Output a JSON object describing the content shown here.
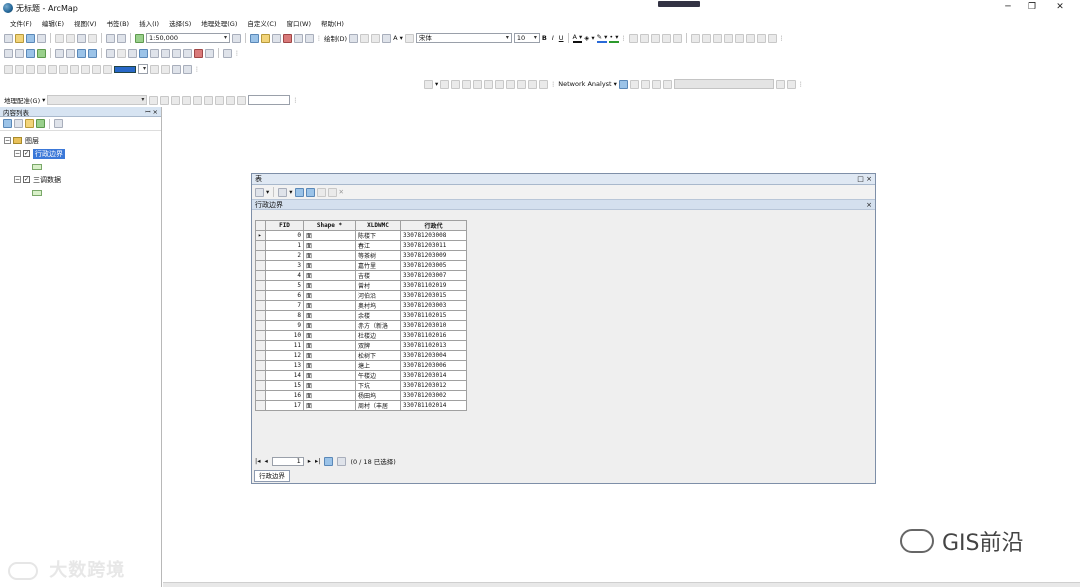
{
  "window": {
    "title": "无标题 - ArcMap"
  },
  "menu": [
    "文件(F)",
    "编辑(E)",
    "视图(V)",
    "书签(B)",
    "插入(I)",
    "选择(S)",
    "地理处理(G)",
    "自定义(C)",
    "窗口(W)",
    "帮助(H)"
  ],
  "toolbar": {
    "scale": "1:50,000",
    "drawing_label": "绘制(D)",
    "font_name": "宋体",
    "font_size": "10",
    "bold": "B",
    "italic": "I",
    "underline": "U",
    "network_analyst": "Network Analyst",
    "georef_label": "地理配准(G)"
  },
  "toc": {
    "title": "内容列表",
    "pin": "ꟷ ×",
    "root": "图层",
    "layers": [
      {
        "name": "行政边界",
        "selected": true,
        "checked": true
      },
      {
        "name": "三调数据",
        "selected": false,
        "checked": true
      }
    ]
  },
  "table": {
    "window_title": "表",
    "window_controls": "□ ×",
    "tab_title": "行政边界",
    "tab_close": "×",
    "columns": [
      "FID",
      "Shape *",
      "XLDWMC",
      "行政代"
    ],
    "rows": [
      [
        "0",
        "面",
        "陈楼下",
        "330781203008"
      ],
      [
        "1",
        "面",
        "春江",
        "330781203011"
      ],
      [
        "2",
        "面",
        "等茶树",
        "330781203009"
      ],
      [
        "3",
        "面",
        "嘉竹里",
        "330781203005"
      ],
      [
        "4",
        "面",
        "吉楼",
        "330781203007"
      ],
      [
        "5",
        "面",
        "曾村",
        "330781102019"
      ],
      [
        "6",
        "面",
        "河伯沿",
        "330781203015"
      ],
      [
        "7",
        "面",
        "奥村坞",
        "330781203003"
      ],
      [
        "8",
        "面",
        "余楼",
        "330781102015"
      ],
      [
        "9",
        "面",
        "赤方（新洛",
        "330781203010"
      ],
      [
        "10",
        "面",
        "杜楼边",
        "330781102016"
      ],
      [
        "11",
        "面",
        "双牌",
        "330781102013"
      ],
      [
        "12",
        "面",
        "松树下",
        "330781203004"
      ],
      [
        "13",
        "面",
        "塘上",
        "330781203006"
      ],
      [
        "14",
        "面",
        "午楼边",
        "330781203014"
      ],
      [
        "15",
        "面",
        "下坑",
        "330781203012"
      ],
      [
        "16",
        "面",
        "杨田坞",
        "330781203002"
      ],
      [
        "17",
        "面",
        "周村（丰居",
        "330781102014"
      ]
    ],
    "current_record": "1",
    "selection_status": "(0 / 18 已选择)",
    "bottom_tab": "行政边界"
  },
  "watermarks": {
    "left": "大数跨境",
    "right": "GIS前沿"
  }
}
